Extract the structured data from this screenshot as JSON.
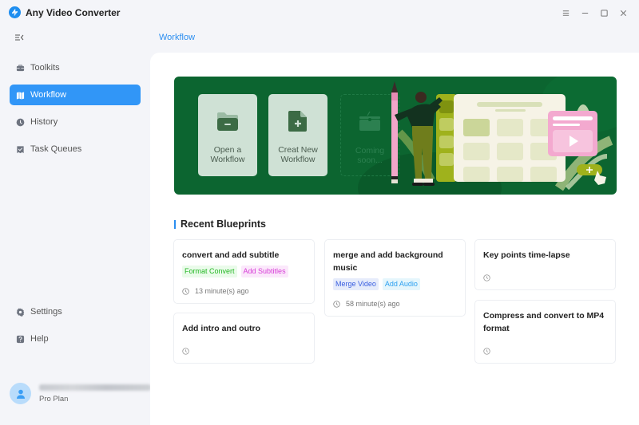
{
  "app": {
    "title": "Any Video Converter",
    "window_controls": [
      "menu-icon",
      "minimize-icon",
      "maximize-icon",
      "close-icon"
    ]
  },
  "sidebar": {
    "items": [
      {
        "label": "Toolkits",
        "icon": "toolbox-icon",
        "active": false
      },
      {
        "label": "Workflow",
        "icon": "workflow-icon",
        "active": true
      },
      {
        "label": "History",
        "icon": "clock-icon",
        "active": false
      },
      {
        "label": "Task Queues",
        "icon": "task-queue-icon",
        "active": false
      }
    ],
    "bottom_items": [
      {
        "label": "Settings",
        "icon": "gear-icon"
      },
      {
        "label": "Help",
        "icon": "help-icon"
      }
    ],
    "user": {
      "email_blurred": true,
      "plan": "Pro Plan"
    }
  },
  "breadcrumb": "Workflow",
  "banner": {
    "cards": [
      {
        "label": "Open a Workflow",
        "icon": "folder-icon",
        "enabled": true
      },
      {
        "label": "Creat New Workflow",
        "icon": "new-file-icon",
        "enabled": true
      },
      {
        "label": "Coming soon...",
        "icon": "toolbox-icon",
        "enabled": false
      }
    ]
  },
  "recent": {
    "title": "Recent Blueprints",
    "blueprints": [
      {
        "title": "convert and add subtitle",
        "tags": [
          {
            "label": "Format Convert",
            "color": "#23b723",
            "bg": "#eafbea"
          },
          {
            "label": "Add Subtitles",
            "color": "#d63bd6",
            "bg": "#fbe8fb"
          }
        ],
        "time": "13 minute(s) ago"
      },
      {
        "title": "merge and add background music",
        "tags": [
          {
            "label": "Merge Video",
            "color": "#3a5fe0",
            "bg": "#e6ecfb"
          },
          {
            "label": "Add Audio",
            "color": "#2a9ff0",
            "bg": "#e5f6fc"
          }
        ],
        "time": "58 minute(s) ago"
      },
      {
        "title": "Key points time-lapse",
        "tags": [],
        "time": ""
      },
      {
        "title": "Add intro and outro",
        "tags": [],
        "time": ""
      },
      {
        "title": "Compress and convert to MP4 format",
        "tags": [],
        "time": ""
      }
    ]
  },
  "colors": {
    "accent": "#3196f7",
    "banner_bg": "#0c6530",
    "banner_card_bg": "#cfe1d5"
  }
}
